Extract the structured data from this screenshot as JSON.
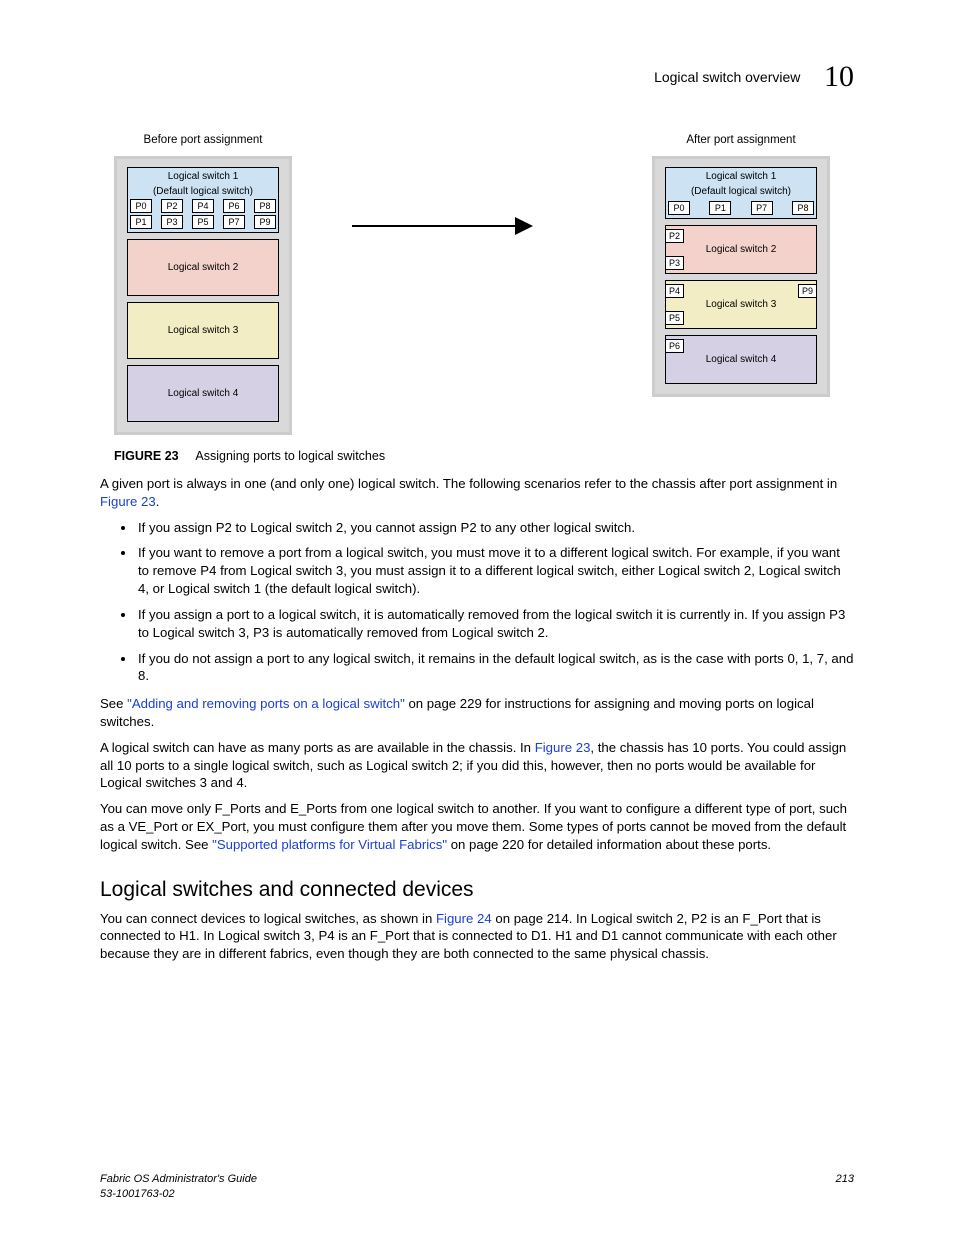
{
  "header": {
    "title": "Logical switch overview",
    "chapter": "10"
  },
  "figure": {
    "before_label": "Before port assignment",
    "after_label": "After port assignment",
    "sw1_title_a": "Logical switch 1",
    "sw1_title_b": "(Default logical switch)",
    "sw2": "Logical switch 2",
    "sw3": "Logical switch 3",
    "sw4": "Logical switch 4",
    "ports": {
      "p0": "P0",
      "p1": "P1",
      "p2": "P2",
      "p3": "P3",
      "p4": "P4",
      "p5": "P5",
      "p6": "P6",
      "p7": "P7",
      "p8": "P8",
      "p9": "P9"
    },
    "caption_label": "FIGURE 23",
    "caption_text": "Assigning ports to logical switches"
  },
  "para1a": "A given port is always in one (and only one) logical switch. The following scenarios refer to the chassis after port assignment in ",
  "para1_link": "Figure 23",
  "para1b": ".",
  "bullets": [
    "If you assign P2 to Logical switch 2, you cannot assign P2 to any other logical switch.",
    "If you want to remove a port from a logical switch, you must move it to a different logical switch. For example, if you want to remove P4 from Logical switch 3, you must assign it to a different logical switch, either Logical switch 2, Logical switch 4, or Logical switch 1 (the default logical switch).",
    "If you assign a port to a logical switch, it is automatically removed from the logical switch it is currently in. If you assign P3 to Logical switch 3, P3 is automatically removed from Logical switch 2.",
    "If you do not assign a port to any logical switch, it remains in the default logical switch, as is the case with ports 0, 1, 7, and 8."
  ],
  "para2a": "See ",
  "para2_link": "\"Adding and removing ports on a logical switch\"",
  "para2b": " on page 229 for instructions for assigning and moving ports on logical switches.",
  "para3a": "A logical switch can have as many ports as are available in the chassis. In ",
  "para3_link": "Figure 23",
  "para3b": ", the chassis has 10 ports. You could assign all 10 ports to a single logical switch, such as Logical switch 2; if you did this, however, then no ports would be available for Logical switches 3 and 4.",
  "para4a": "You can move only F_Ports and E_Ports from one logical switch to another. If you want to configure a different type of port, such as a VE_Port or EX_Port, you must configure them after you move them. Some types of ports cannot be moved from the default logical switch. See ",
  "para4_link": "\"Supported platforms for Virtual Fabrics\"",
  "para4b": " on page 220 for detailed information about these ports.",
  "section_heading": "Logical switches and connected devices",
  "para5a": "You can connect devices to logical switches, as shown in ",
  "para5_link": "Figure 24",
  "para5b": " on page 214. In Logical switch 2, P2 is an F_Port that is connected to H1. In Logical switch 3, P4 is an F_Port that is connected to D1. H1 and D1 cannot communicate with each other because they are in different fabrics, even though they are both connected to the same physical chassis.",
  "footer": {
    "book": "Fabric OS Administrator's Guide",
    "docnum": "53-1001763-02",
    "page": "213"
  }
}
